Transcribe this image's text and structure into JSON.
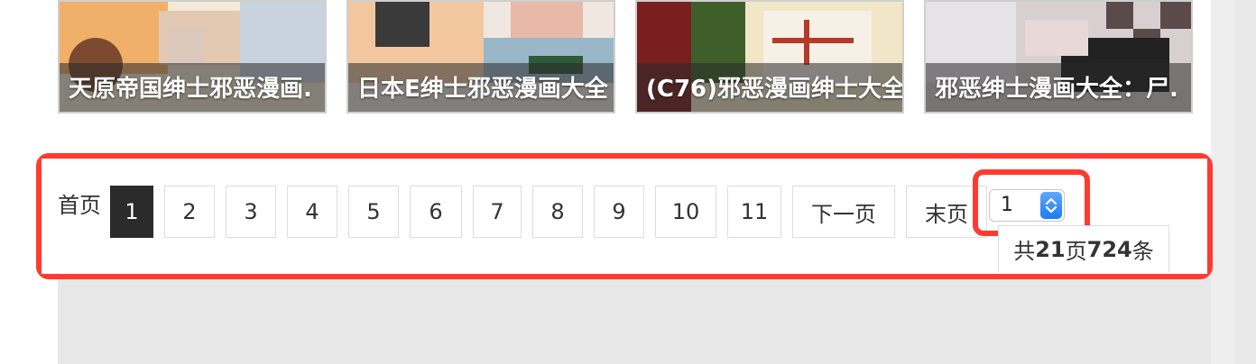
{
  "thumbnails": [
    {
      "caption": "天原帝国绅士邪恶漫画.",
      "colors": [
        "#f1b06a",
        "#e8d6c0",
        "#7b4a2f"
      ]
    },
    {
      "caption": "日本E绅士邪恶漫画大全",
      "colors": [
        "#f2c7a0",
        "#9ab7c9",
        "#3a3a3a"
      ]
    },
    {
      "caption": "(C76)邪恶漫画绅士大全",
      "colors": [
        "#7a1f1f",
        "#f1e6c8",
        "#3f5f2a"
      ]
    },
    {
      "caption": "邪恶绅士漫画大全：尸.",
      "colors": [
        "#d8d0d0",
        "#7a5a6a",
        "#222222"
      ]
    }
  ],
  "pagination": {
    "first_label": "首页",
    "pages": [
      "1",
      "2",
      "3",
      "4",
      "5",
      "6",
      "7",
      "8",
      "9",
      "10",
      "11"
    ],
    "active_page": "1",
    "next_label": "下一页",
    "last_label": "末页",
    "select_value": "1",
    "total": {
      "prefix": "共 ",
      "pages": "21",
      "pages_unit": "页",
      "items": "724",
      "items_unit": "条"
    }
  },
  "highlight_color": "#ff3b30"
}
